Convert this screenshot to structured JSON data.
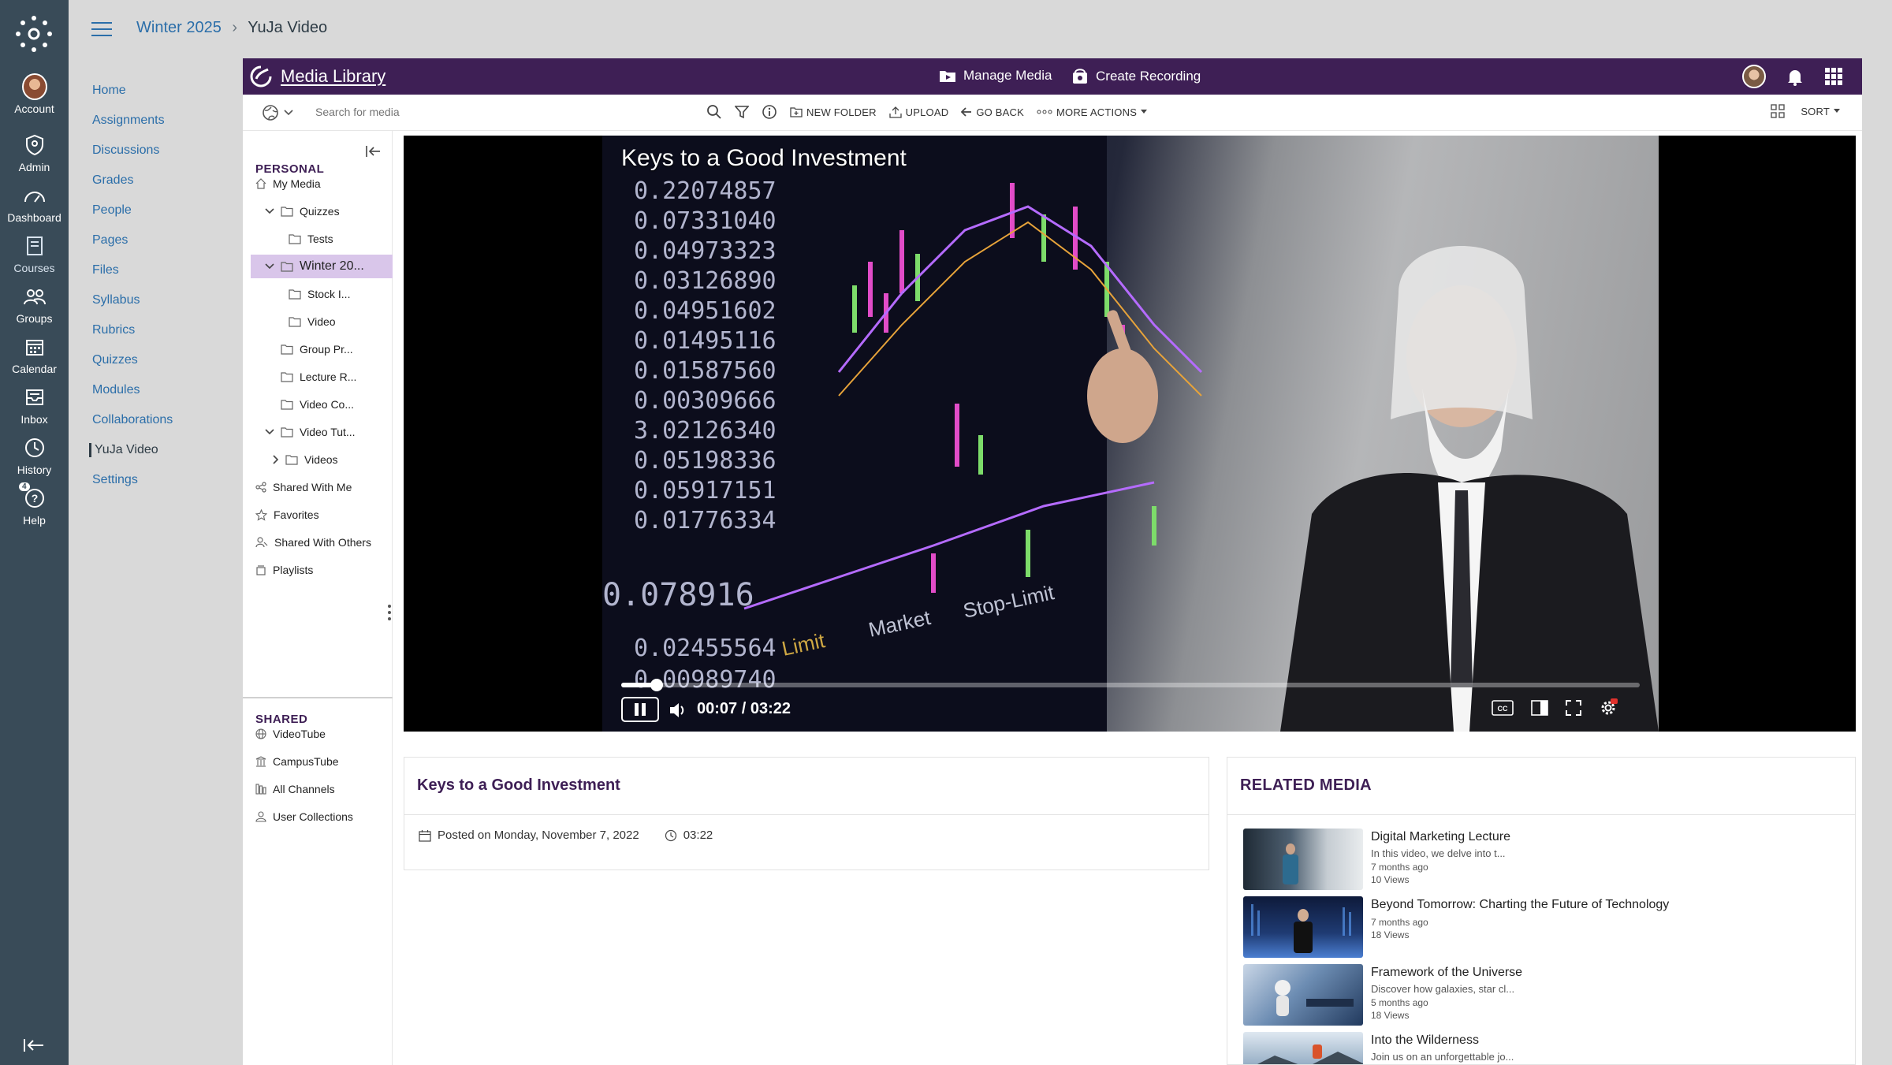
{
  "global_nav": {
    "items": [
      {
        "label": "Account",
        "icon": "account-avatar"
      },
      {
        "label": "Admin",
        "icon": "shield-icon"
      },
      {
        "label": "Dashboard",
        "icon": "dashboard-icon"
      },
      {
        "label": "Courses",
        "icon": "courses-icon"
      },
      {
        "label": "Groups",
        "icon": "groups-icon"
      },
      {
        "label": "Calendar",
        "icon": "calendar-icon"
      },
      {
        "label": "Inbox",
        "icon": "inbox-icon"
      },
      {
        "label": "History",
        "icon": "history-icon"
      },
      {
        "label": "Help",
        "icon": "help-icon",
        "badge": "4"
      }
    ]
  },
  "breadcrumb": {
    "course": "Winter 2025",
    "page": "YuJa Video"
  },
  "course_nav": {
    "items": [
      "Home",
      "Assignments",
      "Discussions",
      "Grades",
      "People",
      "Pages",
      "Files",
      "Syllabus",
      "Rubrics",
      "Quizzes",
      "Modules",
      "Collaborations",
      "YuJa Video",
      "Settings"
    ],
    "active": "YuJa Video"
  },
  "yuja_header": {
    "brand": "Media Library",
    "manage_media": "Manage Media",
    "create_recording": "Create Recording"
  },
  "toolbar": {
    "search_placeholder": "Search for media",
    "new_folder": "NEW FOLDER",
    "upload": "UPLOAD",
    "go_back": "GO BACK",
    "more_actions": "MORE ACTIONS",
    "sort": "SORT"
  },
  "tree": {
    "personal_heading": "PERSONAL",
    "personal": [
      {
        "label": "My Media",
        "icon": "home-icon",
        "indent": 0
      },
      {
        "label": "Quizzes",
        "icon": "folder-icon",
        "indent": 1,
        "expanded": true
      },
      {
        "label": "Tests",
        "icon": "folder-icon",
        "indent": 2
      },
      {
        "label": "Winter 20...",
        "icon": "folder-icon",
        "indent": 1,
        "expanded": true,
        "selected": true
      },
      {
        "label": "Stock I...",
        "icon": "folder-icon",
        "indent": 2
      },
      {
        "label": "Video",
        "icon": "folder-icon",
        "indent": 2
      },
      {
        "label": "Group Pr...",
        "icon": "folder-icon",
        "indent": 1
      },
      {
        "label": "Lecture R...",
        "icon": "folder-icon",
        "indent": 1
      },
      {
        "label": "Video Co...",
        "icon": "folder-icon",
        "indent": 1
      },
      {
        "label": "Video Tut...",
        "icon": "folder-icon",
        "indent": 1,
        "expanded": true
      },
      {
        "label": "Videos",
        "icon": "folder-icon",
        "indent": 2,
        "collapsed": true
      },
      {
        "label": "Shared With Me",
        "icon": "share-icon",
        "indent": 0
      },
      {
        "label": "Favorites",
        "icon": "star-icon",
        "indent": 0
      },
      {
        "label": "Shared With Others",
        "icon": "users-icon",
        "indent": 0
      },
      {
        "label": "Playlists",
        "icon": "playlist-icon",
        "indent": 0
      }
    ],
    "shared_heading": "SHARED",
    "shared": [
      {
        "label": "VideoTube",
        "icon": "globe-icon"
      },
      {
        "label": "CampusTube",
        "icon": "building-icon"
      },
      {
        "label": "All Channels",
        "icon": "channels-icon"
      },
      {
        "label": "User Collections",
        "icon": "user-icon"
      }
    ]
  },
  "player": {
    "title": "Keys to a Good Investment",
    "time": "00:07 / 03:22",
    "progress": 0.035
  },
  "info": {
    "title": "Keys to a Good Investment",
    "posted": "Posted on Monday, November 7, 2022",
    "duration": "03:22"
  },
  "related": {
    "heading": "RELATED MEDIA",
    "items": [
      {
        "title": "Digital Marketing Lecture",
        "desc": "In this video, we delve into t...",
        "age": "7 months ago",
        "views": "10 Views",
        "color": "#6a7e8f"
      },
      {
        "title": "Beyond Tomorrow: Charting the Future of Technology",
        "desc": "",
        "age": "7 months ago",
        "views": "18 Views",
        "color": "#1c2f5a"
      },
      {
        "title": "Framework of the Universe",
        "desc": "Discover how galaxies, star cl...",
        "age": "5 months ago",
        "views": "18 Views",
        "color": "#3a5a88"
      },
      {
        "title": "Into the Wilderness",
        "desc": "Join us on an unforgettable jo...",
        "age": "",
        "views": "",
        "color": "#8aa1b7"
      }
    ]
  }
}
